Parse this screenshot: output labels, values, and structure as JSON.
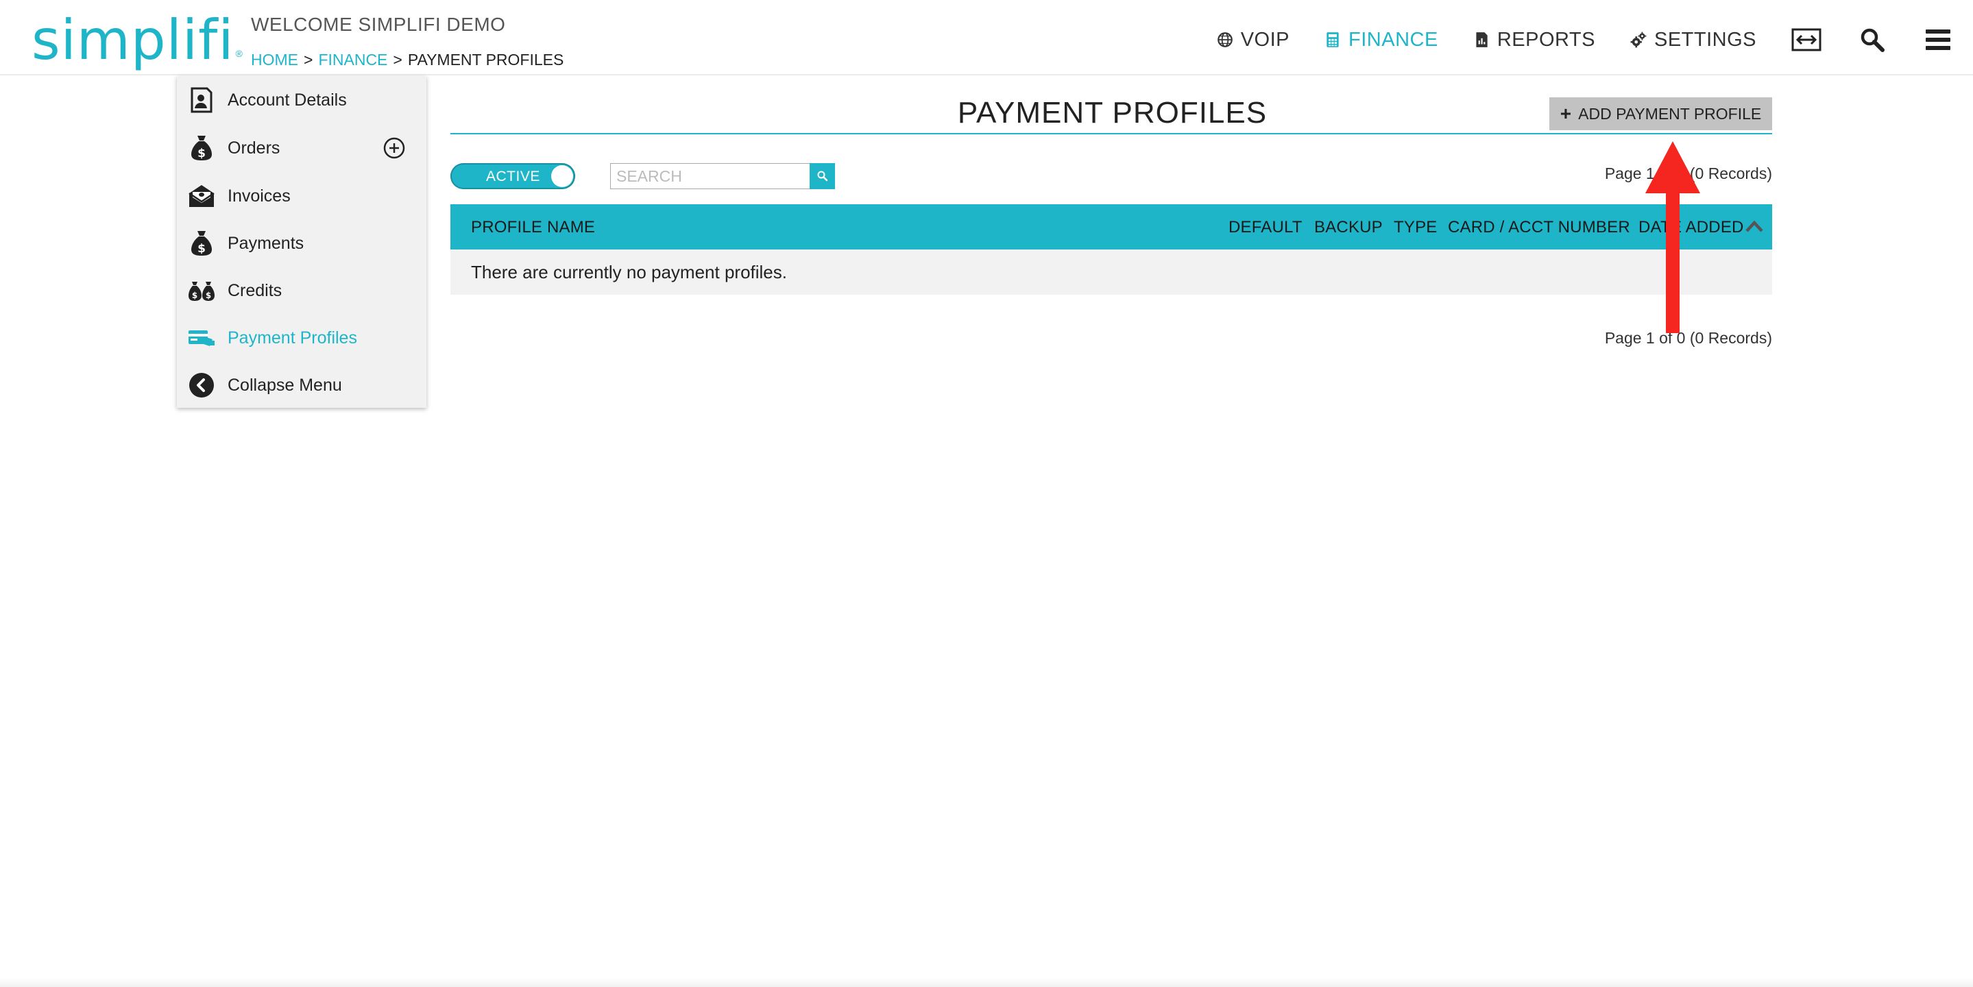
{
  "app": {
    "logo_text": "simplifi",
    "logo_mark": "®",
    "welcome": "WELCOME SIMPLIFI DEMO"
  },
  "breadcrumb": {
    "home": "HOME",
    "sep": ">",
    "finance": "FINANCE",
    "current": "PAYMENT PROFILES"
  },
  "topnav": {
    "items": [
      {
        "label": "VOIP",
        "icon": "globe-icon"
      },
      {
        "label": "FINANCE",
        "icon": "calculator-icon",
        "active": true
      },
      {
        "label": "REPORTS",
        "icon": "report-icon"
      },
      {
        "label": "SETTINGS",
        "icon": "gears-icon"
      }
    ],
    "tools": [
      "expand-arrows-icon",
      "search-icon",
      "hamburger-menu-icon"
    ]
  },
  "sidebar": {
    "items": [
      {
        "label": "Account Details",
        "icon": "account-details-icon"
      },
      {
        "label": "Orders",
        "icon": "money-bag-icon"
      },
      {
        "label": "Invoices",
        "icon": "envelope-money-icon"
      },
      {
        "label": "Payments",
        "icon": "money-bag-icon"
      },
      {
        "label": "Credits",
        "icon": "credits-bags-icon"
      },
      {
        "label": "Payment Profiles",
        "icon": "payment-card-icon",
        "active": true
      },
      {
        "label": "Collapse Menu",
        "icon": "collapse-left-icon"
      }
    ]
  },
  "main": {
    "title": "PAYMENT PROFILES",
    "add_button_plus": "+",
    "add_button_label": "ADD PAYMENT PROFILE",
    "toggle_label": "ACTIVE",
    "search_placeholder": "SEARCH",
    "pager_top": "Page 1 of 0 (0 Records)",
    "pager_bottom": "Page 1 of 0 (0 Records)",
    "table": {
      "columns": [
        "PROFILE NAME",
        "DEFAULT",
        "BACKUP",
        "TYPE",
        "CARD / ACCT NUMBER",
        "DATE ADDED"
      ],
      "empty_message": "There are currently no payment profiles."
    }
  },
  "colors": {
    "accent": "#1fb5c9",
    "button_gray": "#c2c2c2",
    "annotation_red": "#f5251f"
  }
}
